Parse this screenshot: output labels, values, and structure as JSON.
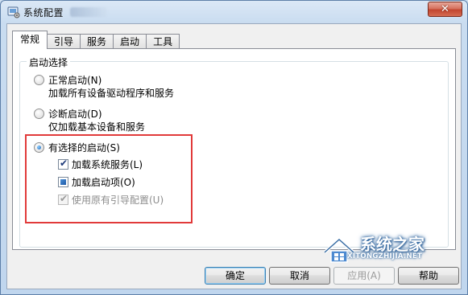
{
  "window": {
    "title": "系统配置",
    "close_glyph": "✕"
  },
  "tabs": [
    {
      "label": "常规",
      "active": true
    },
    {
      "label": "引导",
      "active": false
    },
    {
      "label": "服务",
      "active": false
    },
    {
      "label": "启动",
      "active": false
    },
    {
      "label": "工具",
      "active": false
    }
  ],
  "startup_selection": {
    "legend": "启动选择",
    "options": [
      {
        "label": "正常启动(N)",
        "description": "加载所有设备驱动程序和服务",
        "selected": false
      },
      {
        "label": "诊断启动(D)",
        "description": "仅加载基本设备和服务",
        "selected": false
      },
      {
        "label": "有选择的启动(S)",
        "selected": true
      }
    ],
    "selective_items": [
      {
        "label": "加载系统服务(L)",
        "state": "checked",
        "enabled": true
      },
      {
        "label": "加载启动项(O)",
        "state": "indeterminate",
        "enabled": true
      },
      {
        "label": "使用原有引导配置(U)",
        "state": "checked",
        "enabled": false
      }
    ]
  },
  "buttons": {
    "ok": "确定",
    "cancel": "取消",
    "apply": "应用(A)",
    "help": "帮助"
  },
  "watermark": {
    "name": "系统之家",
    "url": "XITONGZHIJIA.NET"
  },
  "colors": {
    "highlight_border": "#e13a3a",
    "accent": "#1c63b7"
  }
}
